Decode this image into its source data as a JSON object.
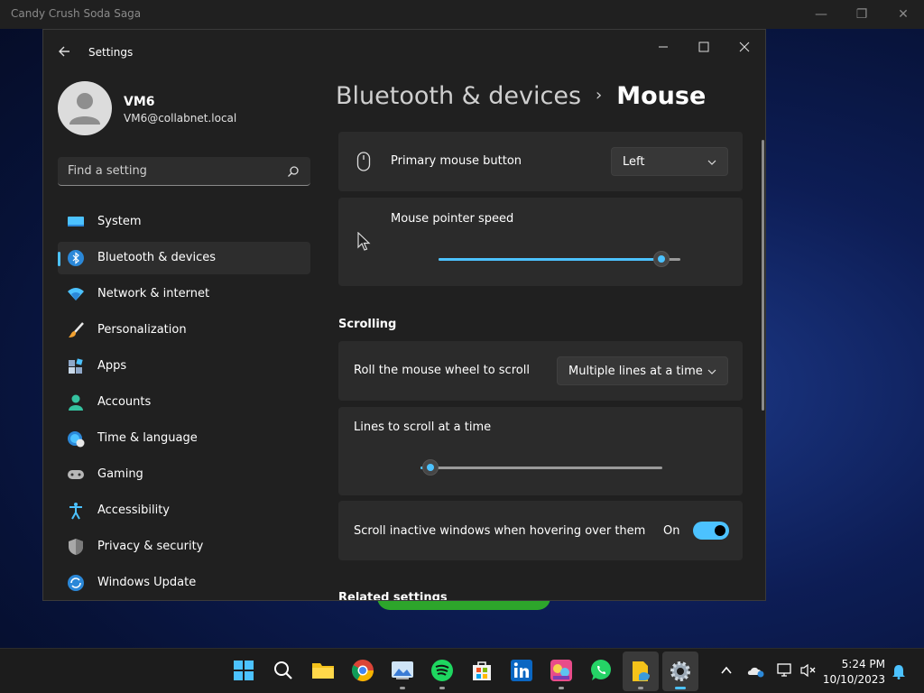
{
  "background_app": {
    "title": "Candy Crush Soda Saga"
  },
  "settings": {
    "app_title": "Settings",
    "user": {
      "name": "VM6",
      "email": "VM6@collabnet.local"
    },
    "search": {
      "placeholder": "Find a setting"
    },
    "nav": [
      {
        "label": "System",
        "icon": "monitor-icon",
        "active": false
      },
      {
        "label": "Bluetooth & devices",
        "icon": "bluetooth-icon",
        "active": true
      },
      {
        "label": "Network & internet",
        "icon": "wifi-icon",
        "active": false
      },
      {
        "label": "Personalization",
        "icon": "brush-icon",
        "active": false
      },
      {
        "label": "Apps",
        "icon": "apps-icon",
        "active": false
      },
      {
        "label": "Accounts",
        "icon": "person-icon",
        "active": false
      },
      {
        "label": "Time & language",
        "icon": "globe-clock-icon",
        "active": false
      },
      {
        "label": "Gaming",
        "icon": "gamepad-icon",
        "active": false
      },
      {
        "label": "Accessibility",
        "icon": "accessibility-icon",
        "active": false
      },
      {
        "label": "Privacy & security",
        "icon": "shield-icon",
        "active": false
      },
      {
        "label": "Windows Update",
        "icon": "update-icon",
        "active": false
      }
    ],
    "breadcrumb": {
      "parent": "Bluetooth & devices",
      "separator": "›",
      "current": "Mouse"
    },
    "primary_button": {
      "label": "Primary mouse button",
      "value": "Left"
    },
    "pointer_speed": {
      "label": "Mouse pointer speed",
      "value_fraction": 0.92
    },
    "scrolling": {
      "heading": "Scrolling",
      "roll": {
        "label": "Roll the mouse wheel to scroll",
        "value": "Multiple lines at a time"
      },
      "lines": {
        "label": "Lines to scroll at a time",
        "value_fraction": 0.04
      },
      "inactive": {
        "label": "Scroll inactive windows when hovering over them",
        "state": "On"
      }
    },
    "related_heading": "Related settings"
  },
  "taskbar": {
    "apps": [
      "start-icon",
      "search-icon",
      "file-explorer-icon",
      "chrome-icon",
      "photos-icon",
      "spotify-icon",
      "store-icon",
      "linkedin-icon",
      "candy-crush-icon",
      "whatsapp-icon",
      "file-share-icon",
      "settings-icon"
    ],
    "time": "5:24 PM",
    "date": "10/10/2023"
  },
  "colors": {
    "accent": "#4cc2ff",
    "window_bg": "#202020",
    "card_bg": "#2b2b2b"
  }
}
